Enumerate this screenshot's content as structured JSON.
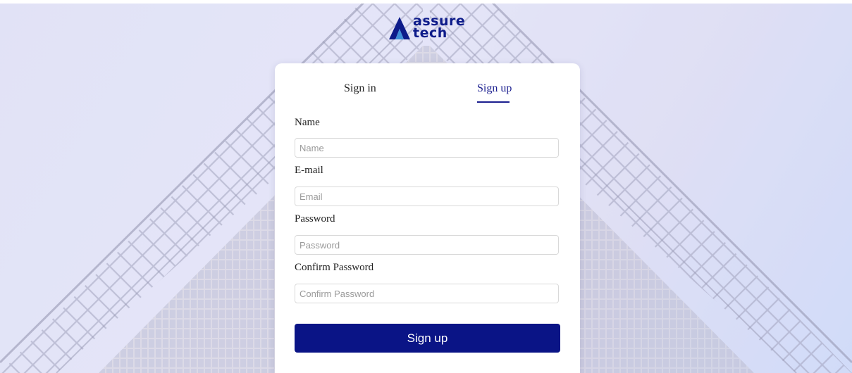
{
  "brand": {
    "name_line1": "assure",
    "name_line2": "tech",
    "color": "#0d1b8a"
  },
  "tabs": [
    {
      "label": "Sign in",
      "active": false
    },
    {
      "label": "Sign up",
      "active": true
    }
  ],
  "form": {
    "name": {
      "label": "Name",
      "placeholder": "Name",
      "value": ""
    },
    "email": {
      "label": "E-mail",
      "placeholder": "Email",
      "value": ""
    },
    "password": {
      "label": "Password",
      "placeholder": "Password",
      "value": ""
    },
    "confirm_password": {
      "label": "Confirm Password",
      "placeholder": "Confirm Password",
      "value": ""
    },
    "submit_label": "Sign up"
  },
  "colors": {
    "accent": "#1b1f8f",
    "button": "#0a1486"
  },
  "icons": {
    "logo": "triangle-logo-icon"
  }
}
